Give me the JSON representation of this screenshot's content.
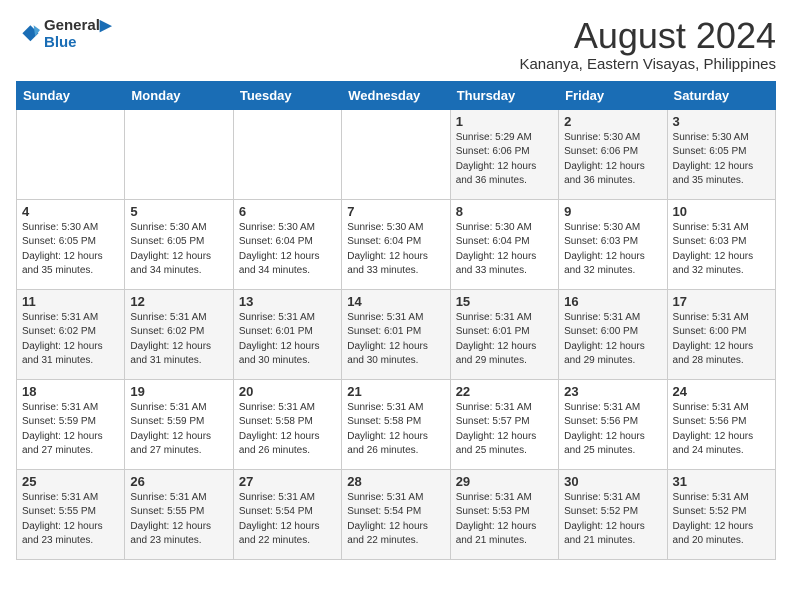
{
  "logo": {
    "line1": "General",
    "line2": "Blue"
  },
  "title": "August 2024",
  "subtitle": "Kananya, Eastern Visayas, Philippines",
  "headers": [
    "Sunday",
    "Monday",
    "Tuesday",
    "Wednesday",
    "Thursday",
    "Friday",
    "Saturday"
  ],
  "weeks": [
    [
      {
        "day": "",
        "info": ""
      },
      {
        "day": "",
        "info": ""
      },
      {
        "day": "",
        "info": ""
      },
      {
        "day": "",
        "info": ""
      },
      {
        "day": "1",
        "info": "Sunrise: 5:29 AM\nSunset: 6:06 PM\nDaylight: 12 hours\nand 36 minutes."
      },
      {
        "day": "2",
        "info": "Sunrise: 5:30 AM\nSunset: 6:06 PM\nDaylight: 12 hours\nand 36 minutes."
      },
      {
        "day": "3",
        "info": "Sunrise: 5:30 AM\nSunset: 6:05 PM\nDaylight: 12 hours\nand 35 minutes."
      }
    ],
    [
      {
        "day": "4",
        "info": "Sunrise: 5:30 AM\nSunset: 6:05 PM\nDaylight: 12 hours\nand 35 minutes."
      },
      {
        "day": "5",
        "info": "Sunrise: 5:30 AM\nSunset: 6:05 PM\nDaylight: 12 hours\nand 34 minutes."
      },
      {
        "day": "6",
        "info": "Sunrise: 5:30 AM\nSunset: 6:04 PM\nDaylight: 12 hours\nand 34 minutes."
      },
      {
        "day": "7",
        "info": "Sunrise: 5:30 AM\nSunset: 6:04 PM\nDaylight: 12 hours\nand 33 minutes."
      },
      {
        "day": "8",
        "info": "Sunrise: 5:30 AM\nSunset: 6:04 PM\nDaylight: 12 hours\nand 33 minutes."
      },
      {
        "day": "9",
        "info": "Sunrise: 5:30 AM\nSunset: 6:03 PM\nDaylight: 12 hours\nand 32 minutes."
      },
      {
        "day": "10",
        "info": "Sunrise: 5:31 AM\nSunset: 6:03 PM\nDaylight: 12 hours\nand 32 minutes."
      }
    ],
    [
      {
        "day": "11",
        "info": "Sunrise: 5:31 AM\nSunset: 6:02 PM\nDaylight: 12 hours\nand 31 minutes."
      },
      {
        "day": "12",
        "info": "Sunrise: 5:31 AM\nSunset: 6:02 PM\nDaylight: 12 hours\nand 31 minutes."
      },
      {
        "day": "13",
        "info": "Sunrise: 5:31 AM\nSunset: 6:01 PM\nDaylight: 12 hours\nand 30 minutes."
      },
      {
        "day": "14",
        "info": "Sunrise: 5:31 AM\nSunset: 6:01 PM\nDaylight: 12 hours\nand 30 minutes."
      },
      {
        "day": "15",
        "info": "Sunrise: 5:31 AM\nSunset: 6:01 PM\nDaylight: 12 hours\nand 29 minutes."
      },
      {
        "day": "16",
        "info": "Sunrise: 5:31 AM\nSunset: 6:00 PM\nDaylight: 12 hours\nand 29 minutes."
      },
      {
        "day": "17",
        "info": "Sunrise: 5:31 AM\nSunset: 6:00 PM\nDaylight: 12 hours\nand 28 minutes."
      }
    ],
    [
      {
        "day": "18",
        "info": "Sunrise: 5:31 AM\nSunset: 5:59 PM\nDaylight: 12 hours\nand 27 minutes."
      },
      {
        "day": "19",
        "info": "Sunrise: 5:31 AM\nSunset: 5:59 PM\nDaylight: 12 hours\nand 27 minutes."
      },
      {
        "day": "20",
        "info": "Sunrise: 5:31 AM\nSunset: 5:58 PM\nDaylight: 12 hours\nand 26 minutes."
      },
      {
        "day": "21",
        "info": "Sunrise: 5:31 AM\nSunset: 5:58 PM\nDaylight: 12 hours\nand 26 minutes."
      },
      {
        "day": "22",
        "info": "Sunrise: 5:31 AM\nSunset: 5:57 PM\nDaylight: 12 hours\nand 25 minutes."
      },
      {
        "day": "23",
        "info": "Sunrise: 5:31 AM\nSunset: 5:56 PM\nDaylight: 12 hours\nand 25 minutes."
      },
      {
        "day": "24",
        "info": "Sunrise: 5:31 AM\nSunset: 5:56 PM\nDaylight: 12 hours\nand 24 minutes."
      }
    ],
    [
      {
        "day": "25",
        "info": "Sunrise: 5:31 AM\nSunset: 5:55 PM\nDaylight: 12 hours\nand 23 minutes."
      },
      {
        "day": "26",
        "info": "Sunrise: 5:31 AM\nSunset: 5:55 PM\nDaylight: 12 hours\nand 23 minutes."
      },
      {
        "day": "27",
        "info": "Sunrise: 5:31 AM\nSunset: 5:54 PM\nDaylight: 12 hours\nand 22 minutes."
      },
      {
        "day": "28",
        "info": "Sunrise: 5:31 AM\nSunset: 5:54 PM\nDaylight: 12 hours\nand 22 minutes."
      },
      {
        "day": "29",
        "info": "Sunrise: 5:31 AM\nSunset: 5:53 PM\nDaylight: 12 hours\nand 21 minutes."
      },
      {
        "day": "30",
        "info": "Sunrise: 5:31 AM\nSunset: 5:52 PM\nDaylight: 12 hours\nand 21 minutes."
      },
      {
        "day": "31",
        "info": "Sunrise: 5:31 AM\nSunset: 5:52 PM\nDaylight: 12 hours\nand 20 minutes."
      }
    ]
  ]
}
